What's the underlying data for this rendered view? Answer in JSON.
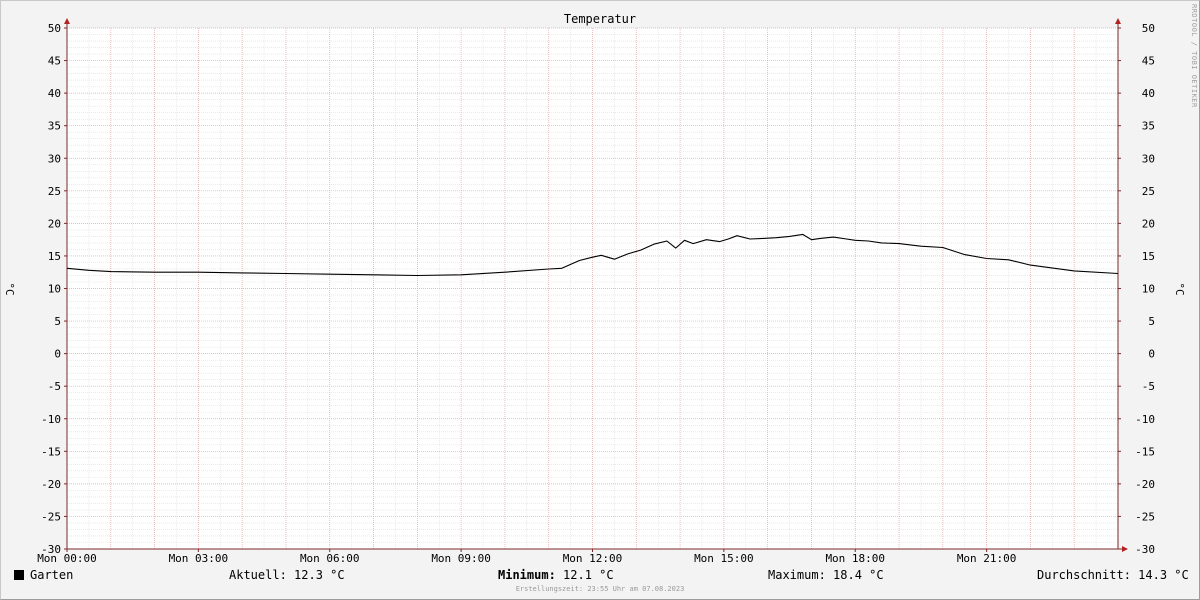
{
  "chart_data": {
    "type": "line",
    "title": "Temperatur",
    "ylabel": "°C",
    "ylim": [
      -30,
      50
    ],
    "yticks": [
      50,
      45,
      40,
      35,
      30,
      25,
      20,
      15,
      10,
      5,
      0,
      -5,
      -10,
      -15,
      -20,
      -25,
      -30
    ],
    "xlim": [
      0,
      24
    ],
    "xticks": [
      {
        "x": 0,
        "label": "Mon 00:00"
      },
      {
        "x": 3,
        "label": "Mon 03:00"
      },
      {
        "x": 6,
        "label": "Mon 06:00"
      },
      {
        "x": 9,
        "label": "Mon 09:00"
      },
      {
        "x": 12,
        "label": "Mon 12:00"
      },
      {
        "x": 15,
        "label": "Mon 15:00"
      },
      {
        "x": 18,
        "label": "Mon 18:00"
      },
      {
        "x": 21,
        "label": "Mon 21:00"
      }
    ],
    "grid": true,
    "series": [
      {
        "name": "Garten",
        "color": "#000000",
        "x": [
          0,
          0.5,
          1,
          2,
          3,
          4,
          5,
          6,
          7,
          8,
          9,
          10,
          11,
          11.3,
          11.7,
          12,
          12.2,
          12.5,
          12.8,
          13.1,
          13.4,
          13.7,
          13.9,
          14.1,
          14.3,
          14.6,
          14.9,
          15.1,
          15.3,
          15.6,
          15.9,
          16.2,
          16.5,
          16.8,
          17.0,
          17.2,
          17.5,
          17.8,
          18.0,
          18.3,
          18.6,
          19,
          19.5,
          20,
          20.5,
          21,
          21.5,
          22,
          23,
          24
        ],
        "y": [
          13.1,
          12.8,
          12.6,
          12.5,
          12.5,
          12.4,
          12.3,
          12.2,
          12.1,
          12.0,
          12.1,
          12.5,
          13.0,
          13.1,
          14.3,
          14.8,
          15.1,
          14.5,
          15.3,
          15.9,
          16.8,
          17.3,
          16.2,
          17.4,
          16.9,
          17.5,
          17.2,
          17.6,
          18.1,
          17.6,
          17.7,
          17.8,
          18.0,
          18.3,
          17.5,
          17.7,
          17.9,
          17.6,
          17.4,
          17.3,
          17.0,
          16.9,
          16.5,
          16.3,
          15.2,
          14.6,
          14.4,
          13.6,
          12.7,
          12.3
        ]
      }
    ],
    "legend": {
      "series": "Garten",
      "current": "Aktuell: 12.3 °C",
      "minimum_label": "Minimum:",
      "minimum_value": " 12.1 °C",
      "maximum": "Maximum: 18.4 °C",
      "average": "Durchschnitt: 14.3 °C"
    },
    "footer": "Erstellungszeit: 23:55 Uhr am 07.08.2023",
    "watermark": "RRDTOOL / TOBI OETIKER"
  }
}
